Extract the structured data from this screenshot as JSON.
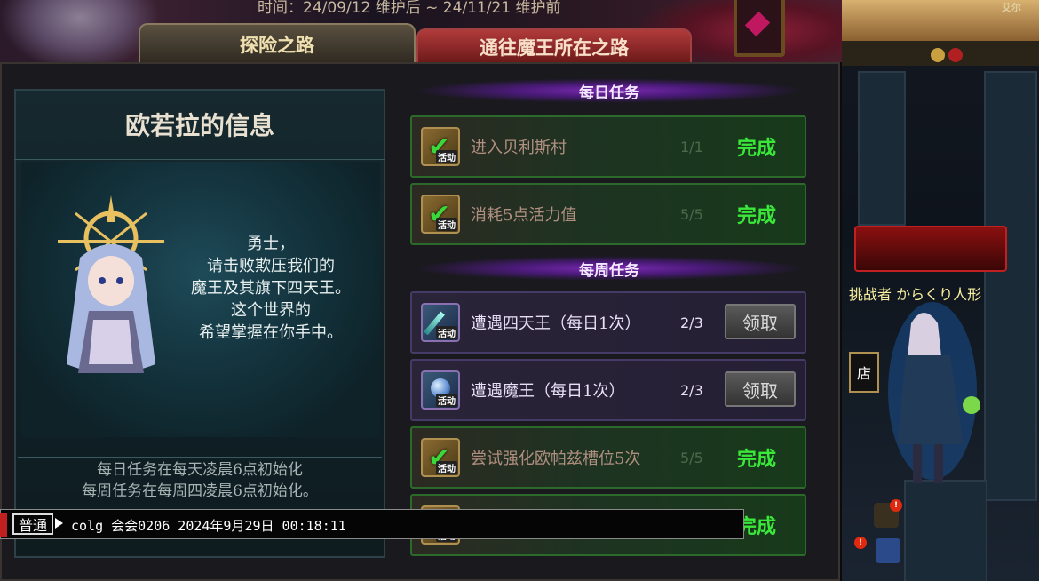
{
  "banner": {
    "period_text": "时间：24/09/12 维护后 ~ 24/11/21 维护前"
  },
  "tabs": [
    {
      "label": "探险之路",
      "active": true
    },
    {
      "label": "通往魔王所在之路",
      "active": false
    }
  ],
  "info": {
    "title": "欧若拉的信息",
    "dialog": [
      "勇士，",
      "请击败欺压我们的",
      "魔王及其旗下四天王。",
      "这个世界的",
      "希望掌握在你手中。"
    ],
    "reset_notes": [
      "每日任务在每天凌晨6点初始化",
      "每周任务在每周四凌晨6点初始化。"
    ]
  },
  "daily": {
    "title": "每日任务",
    "tasks": [
      {
        "name": "进入贝利斯村",
        "progress": "1/1",
        "status": "完成",
        "icon": "check-icon",
        "icon_tag": "活动"
      },
      {
        "name": "消耗5点活力值",
        "progress": "5/5",
        "status": "完成",
        "icon": "check-icon",
        "icon_tag": "活动"
      }
    ]
  },
  "weekly": {
    "title": "每周任务",
    "tasks": [
      {
        "name": "遭遇四天王（每日1次）",
        "progress": "2/3",
        "action": "领取",
        "icon": "sword-icon",
        "icon_tag": "活动"
      },
      {
        "name": "遭遇魔王（每日1次）",
        "progress": "2/3",
        "action": "领取",
        "icon": "orb-icon",
        "icon_tag": "活动"
      },
      {
        "name": "尝试强化欧帕兹槽位5次",
        "progress": "5/5",
        "status": "完成",
        "icon": "check-icon",
        "icon_tag": "活动"
      },
      {
        "name": "",
        "progress": "",
        "status": "完成",
        "icon": "check-icon",
        "icon_tag": "活动"
      }
    ]
  },
  "chat": {
    "channel": "普通",
    "message": "colg 会会0206 2024年9月29日 00:18:11"
  },
  "scene": {
    "top_label": "艾尔",
    "name_prefix": "挑战者",
    "name": "からくり人形",
    "shop_label": "店"
  },
  "colors": {
    "done_green": "#3ae83a",
    "section_purple": "#7a2ab0",
    "accent_red": "#c02020"
  }
}
